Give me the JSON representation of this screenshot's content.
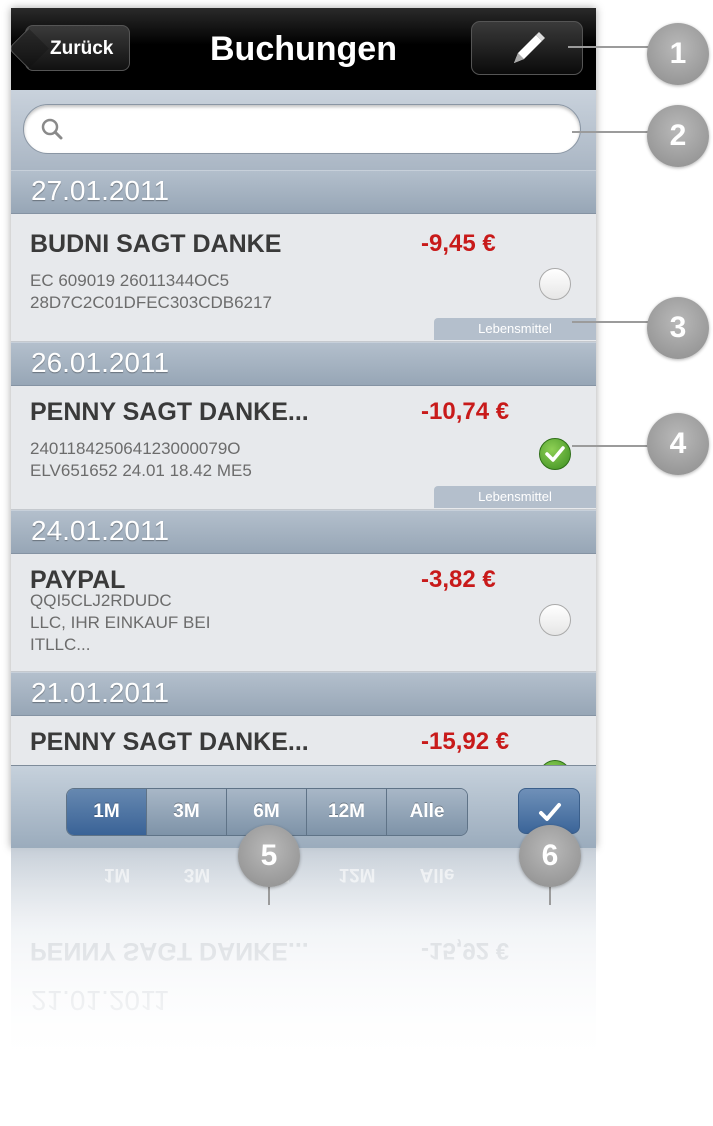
{
  "navbar": {
    "back_label": "Zurück",
    "title": "Buchungen",
    "edit_icon": "pencil-icon"
  },
  "search": {
    "placeholder": "",
    "value": "",
    "icon": "search-icon"
  },
  "sections": [
    {
      "date": "27.01.2011",
      "transactions": [
        {
          "merchant": "BUDNI SAGT DANKE",
          "amount": "-9,45 €",
          "details": [
            "EC 609019 26011344OC5",
            "28D7C2C01DFEC303CDB6217"
          ],
          "category": "Lebensmittel",
          "checked": false
        }
      ]
    },
    {
      "date": "26.01.2011",
      "transactions": [
        {
          "merchant": "PENNY SAGT DANKE...",
          "amount": "-10,74 €",
          "details": [
            "240118425064123000079O",
            "ELV651652 24.01 18.42 ME5"
          ],
          "category": "Lebensmittel",
          "checked": true
        }
      ]
    },
    {
      "date": "24.01.2011",
      "transactions": [
        {
          "merchant": "PAYPAL",
          "amount": "-3,82 €",
          "details": [
            "QQI5CLJ2RDUDC",
            "LLC, IHR EINKAUF BEI",
            "ITLLC..."
          ],
          "category": "",
          "checked": false
        }
      ]
    },
    {
      "date": "21.01.2011",
      "transactions": [
        {
          "merchant": "PENNY SAGT DANKE...",
          "amount": "-15,92 €",
          "details": [],
          "category": "",
          "checked": true
        }
      ]
    }
  ],
  "toolbar": {
    "periods": [
      "1M",
      "3M",
      "6M",
      "12M",
      "Alle"
    ],
    "selected_period": "1M",
    "done_icon": "checkmark-icon"
  },
  "callouts": [
    "1",
    "2",
    "3",
    "4",
    "5",
    "6"
  ],
  "colors": {
    "amount": "#c81a1a",
    "accent": "#3a6397",
    "navbar": "#000000",
    "callout": "#9b9b9b"
  }
}
